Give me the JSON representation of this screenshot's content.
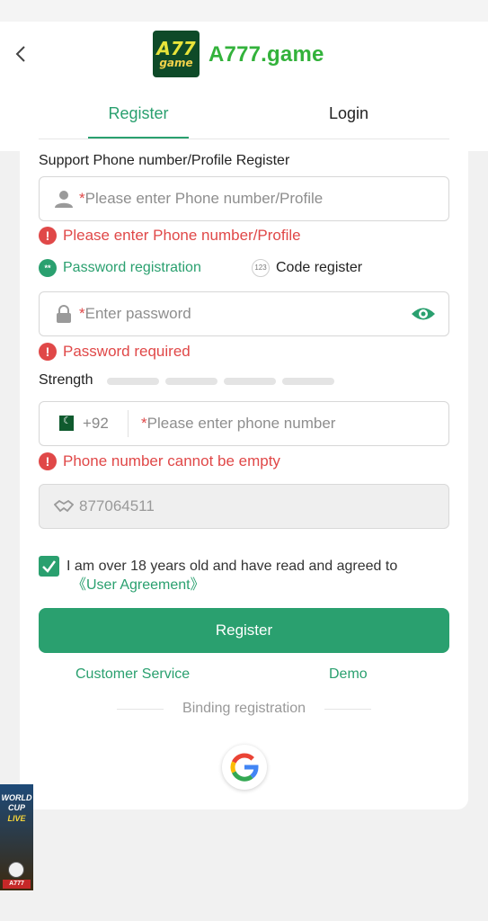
{
  "header": {
    "back_icon": "chevron-left-icon",
    "logo_text_top": "A77",
    "logo_text_bottom": "game",
    "brand": "A777.game"
  },
  "tabs": [
    {
      "label": "Register",
      "active": true
    },
    {
      "label": "Login",
      "active": false
    }
  ],
  "form": {
    "account_label": "Support Phone number/Profile Register",
    "account_icon": "user-icon",
    "account_placeholder": "Please enter Phone number/Profile",
    "account_error": "Please enter Phone number/Profile",
    "options": {
      "password_label": "Password registration",
      "password_icon_text": "**",
      "code_label": "Code register",
      "code_icon_text": "123"
    },
    "password_icon": "lock-icon",
    "password_placeholder": "Enter password",
    "password_visibility_icon": "eye-icon",
    "password_error": "Password required",
    "strength_label": "Strength",
    "strength_level": 0,
    "phone_flag_icon": "pakistan-flag-icon",
    "dial_code": "+92",
    "phone_placeholder": "Please enter phone number",
    "phone_error": "Phone number cannot be empty",
    "invite_icon": "handshake-icon",
    "invite_code": "877064511",
    "agree_checked": true,
    "agree_text": "I am over 18 years old and have read and agreed to",
    "agree_link": "《User Agreement》",
    "submit_label": "Register"
  },
  "links": {
    "customer_service": "Customer Service",
    "demo": "Demo"
  },
  "binding": {
    "label": "Binding registration",
    "google_icon": "google-icon"
  },
  "promo": {
    "line1": "WORLD",
    "line2": "CUP",
    "line3": "LIVE",
    "badge": "A777"
  },
  "colors": {
    "accent": "#2aa06f",
    "error": "#e04848",
    "brand": "#33b23b"
  }
}
